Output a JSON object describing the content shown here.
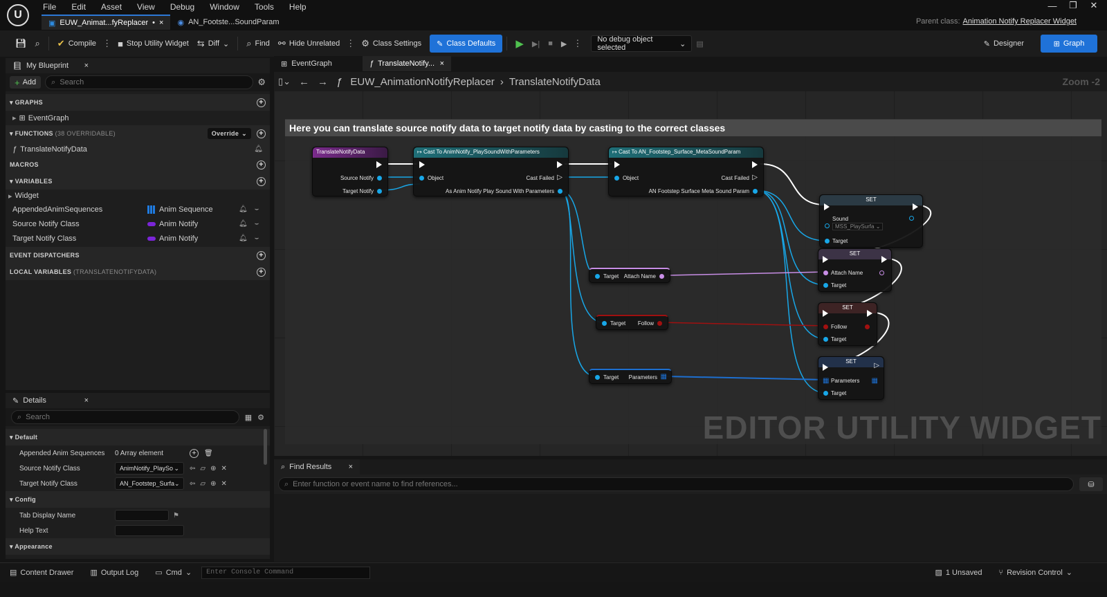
{
  "menu": [
    "File",
    "Edit",
    "Asset",
    "View",
    "Debug",
    "Window",
    "Tools",
    "Help"
  ],
  "doc_tabs": [
    {
      "label": "EUW_Animat...fyReplacer",
      "modified": "•"
    },
    {
      "label": "AN_Footste...SoundParam"
    }
  ],
  "parent_class": {
    "label": "Parent class:",
    "value": "Animation Notify Replacer Widget"
  },
  "toolbar": {
    "compile": "Compile",
    "stop_utility_widget": "Stop Utility Widget",
    "diff": "Diff",
    "find": "Find",
    "hide_unrelated": "Hide Unrelated",
    "class_settings": "Class Settings",
    "class_defaults": "Class Defaults",
    "debug_object": "No debug object selected",
    "designer": "Designer",
    "graph": "Graph"
  },
  "my_blueprint": {
    "tab": "My Blueprint",
    "add": "Add",
    "search_placeholder": "Search",
    "graphs_header": "GRAPHS",
    "event_graph": "EventGraph",
    "functions_header": "FUNCTIONS",
    "functions_overridable": "(38 OVERRIDABLE)",
    "override": "Override",
    "function_item": "TranslateNotifyData",
    "macros_header": "MACROS",
    "variables_header": "VARIABLES",
    "widget_category": "Widget",
    "variables": [
      {
        "name": "AppendedAnimSequences",
        "type": "Anim Sequence"
      },
      {
        "name": "Source Notify Class",
        "type": "Anim Notify"
      },
      {
        "name": "Target Notify Class",
        "type": "Anim Notify"
      }
    ],
    "event_dispatchers_header": "EVENT DISPATCHERS",
    "local_variables_header": "LOCAL VARIABLES",
    "local_variables_scope": "(TRANSLATENOTIFYDATA)"
  },
  "details": {
    "tab": "Details",
    "search_placeholder": "Search",
    "default_header": "Default",
    "appended_label": "Appended Anim Sequences",
    "appended_value": "0 Array element",
    "source_label": "Source Notify Class",
    "source_value": "AnimNotify_PlaySo",
    "target_label": "Target Notify Class",
    "target_value": "AN_Footstep_Surfa",
    "config_header": "Config",
    "tab_display_name": "Tab Display Name",
    "help_text": "Help Text",
    "appearance_header": "Appearance"
  },
  "graph_tabs": [
    "EventGraph",
    "TranslateNotify..."
  ],
  "breadcrumb": {
    "root": "EUW_AnimationNotifyReplacer",
    "current": "TranslateNotifyData"
  },
  "zoom": "Zoom -2",
  "comment": "Here you can translate source notify data to target notify data by casting to the correct classes",
  "nodes": {
    "entry": {
      "title": "TranslateNotifyData",
      "pins": [
        "Source Notify",
        "Target Notify"
      ]
    },
    "cast1": {
      "title": "Cast To AnimNotify_PlaySoundWithParameters",
      "object": "Object",
      "failed": "Cast Failed",
      "as": "As Anim Notify Play Sound With Parameters"
    },
    "cast2": {
      "title": "Cast To AN_Footstep_Surface_MetaSoundParam",
      "object": "Object",
      "failed": "Cast Failed",
      "as": "AN Footstep Surface Meta Sound Param"
    },
    "get_attach": {
      "target": "Target",
      "out": "Attach Name"
    },
    "get_follow": {
      "target": "Target",
      "out": "Follow"
    },
    "get_params": {
      "target": "Target",
      "out": "Parameters"
    },
    "set_sound": {
      "title": "SET",
      "pin": "Sound",
      "value": "MSS_PlaySurfa",
      "target": "Target"
    },
    "set_attach": {
      "title": "SET",
      "pin": "Attach Name",
      "target": "Target"
    },
    "set_follow": {
      "title": "SET",
      "pin": "Follow",
      "target": "Target"
    },
    "set_params": {
      "title": "SET",
      "pin": "Parameters",
      "target": "Target"
    }
  },
  "watermark": "EDITOR UTILITY WIDGET",
  "find_results": {
    "tab": "Find Results",
    "placeholder": "Enter function or event name to find references..."
  },
  "statusbar": {
    "content_drawer": "Content Drawer",
    "output_log": "Output Log",
    "cmd": "Cmd",
    "console_placeholder": "Enter Console Command",
    "unsaved": "1 Unsaved",
    "revision_control": "Revision Control"
  },
  "colors": {
    "accent": "#1f72d8",
    "exec": "#ffffff",
    "object_pin": "#18a7e8",
    "name_pin": "#c88ee6",
    "bool_pin": "#a11010",
    "class_pin": "#7b25d8"
  }
}
